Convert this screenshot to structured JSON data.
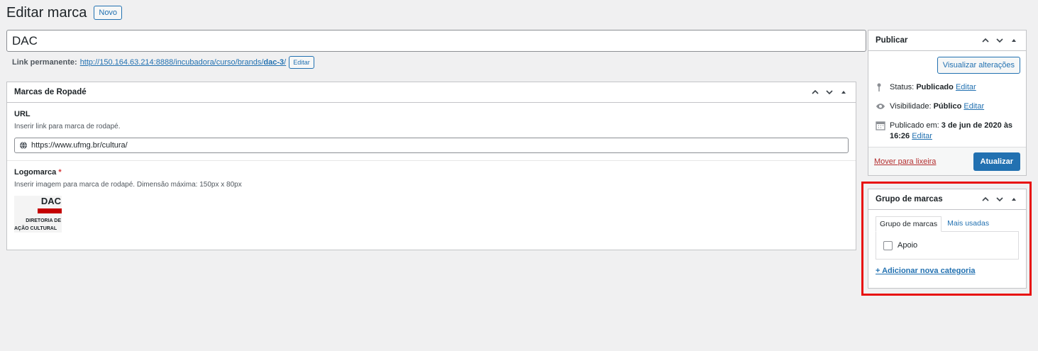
{
  "header": {
    "title": "Editar marca",
    "new_button": "Novo"
  },
  "post": {
    "title": "DAC"
  },
  "permalink": {
    "label": "Link permanente:",
    "url_base": "http://150.164.63.214:8888/incubadora/curso/brands/",
    "url_slug": "dac-3",
    "url_end": "/",
    "edit_button": "Editar"
  },
  "marcas_box": {
    "title": "Marcas de Ropadé",
    "url_field": {
      "label": "URL",
      "description": "Inserir link para marca de rodapé.",
      "value": "https://www.ufmg.br/cultura/",
      "icon": "globe-icon"
    },
    "logo_field": {
      "label": "Logomarca",
      "required_mark": "*",
      "description": "Inserir imagem para marca de rodapé. Dimensão máxima: 150px x 80px",
      "logo_text": {
        "line1": "DAC",
        "line2": "DIRETORIA DE",
        "line3": "AÇÃO CULTURAL"
      }
    }
  },
  "publicar": {
    "title": "Publicar",
    "preview_button": "Visualizar alterações",
    "status_label": "Status:",
    "status_value": "Publicado",
    "status_edit": "Editar",
    "visibility_label": "Visibilidade:",
    "visibility_value": "Público",
    "visibility_edit": "Editar",
    "published_label": "Publicado em:",
    "published_value": "3 de jun de 2020 às 16:26",
    "published_edit": "Editar",
    "trash_link": "Mover para lixeira",
    "update_button": "Atualizar"
  },
  "grupo": {
    "title": "Grupo de marcas",
    "tabs": [
      "Grupo de marcas",
      "Mais usadas"
    ],
    "categories": [
      {
        "label": "Apoio",
        "checked": false
      }
    ],
    "add_link": "+ Adicionar nova categoria"
  },
  "colors": {
    "accent": "#2271b1",
    "highlight": "#e8100f",
    "logo_red": "#c40000"
  }
}
